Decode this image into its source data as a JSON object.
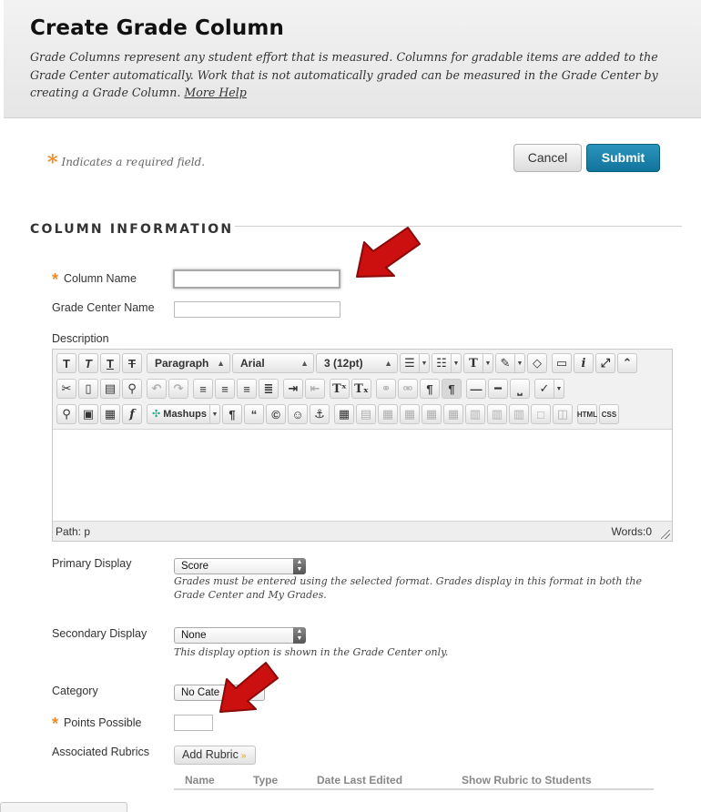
{
  "header": {
    "title": "Create Grade Column",
    "description": "Grade Columns represent any student effort that is measured. Columns for gradable items are added to the Grade Center automatically. Work that is not automatically graded can be measured in the Grade Center by creating a Grade Column.",
    "more_help": "More Help"
  },
  "required_note": "Indicates a required field.",
  "buttons": {
    "cancel": "Cancel",
    "submit": "Submit"
  },
  "section": {
    "title": "COLUMN INFORMATION"
  },
  "fields": {
    "column_name": {
      "label": "Column Name",
      "value": ""
    },
    "grade_center_name": {
      "label": "Grade Center Name",
      "value": ""
    },
    "description": {
      "label": "Description"
    },
    "primary_display": {
      "label": "Primary Display",
      "selected": "Score",
      "help": "Grades must be entered using the selected format. Grades display in this format in both the Grade Center and My Grades."
    },
    "secondary_display": {
      "label": "Secondary Display",
      "selected": "None",
      "help": "This display option is shown in the Grade Center only."
    },
    "category": {
      "label": "Category",
      "selected": "No Cate"
    },
    "points_possible": {
      "label": "Points Possible",
      "value": ""
    },
    "associated_rubrics": {
      "label": "Associated Rubrics",
      "button": "Add Rubric"
    }
  },
  "editor": {
    "format_select": "Paragraph",
    "font_select": "Arial",
    "size_select": "3 (12pt)",
    "mashups": "Mashups",
    "html_btn": "HTML",
    "css_btn": "CSS",
    "path": "Path: p",
    "words": "Words:0"
  },
  "rubric_table": {
    "columns": [
      "Name",
      "Type",
      "Date Last Edited",
      "Show Rubric to Students"
    ]
  },
  "colors": {
    "required_star": "#f5891f",
    "submit_bg": "#1a80aa",
    "annotation_arrow": "#cc1010"
  }
}
